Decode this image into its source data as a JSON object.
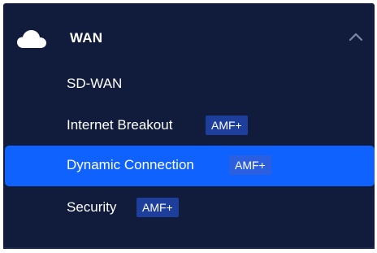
{
  "section": {
    "title": "WAN",
    "icon": "cloud-icon",
    "toggle_icon": "chevron-up-icon",
    "expanded": true
  },
  "items": [
    {
      "label": "SD-WAN",
      "badge": "",
      "active": false
    },
    {
      "label": "Internet Breakout",
      "badge": "AMF+",
      "active": false
    },
    {
      "label": "Dynamic Connection",
      "badge": "AMF+",
      "active": true
    },
    {
      "label": "Security",
      "badge": "AMF+",
      "active": false
    }
  ],
  "colors": {
    "panel_background": "#111b3c",
    "active_background": "#0f62fe",
    "badge_background": "#1d3f9b",
    "text": "#ffffff"
  }
}
